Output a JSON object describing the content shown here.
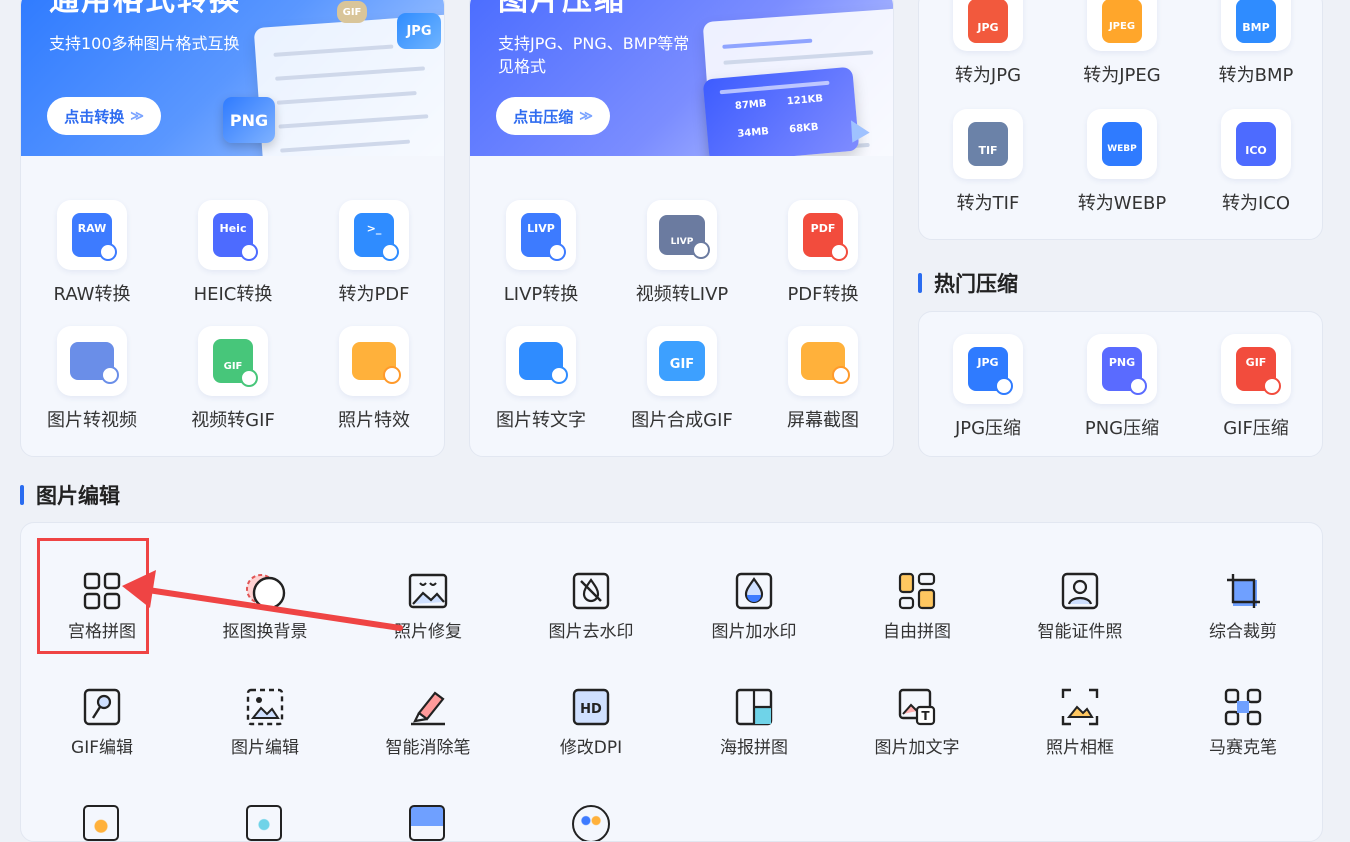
{
  "convert_card": {
    "title": "通用格式转换",
    "subtitle": "支持100多种图片格式互换",
    "button": "点击转换",
    "badge_jpg": "JPG",
    "badge_png": "PNG",
    "badge_gif": "GIF",
    "tiles": [
      {
        "label": "RAW转换",
        "tag": "RAW",
        "color": "#3d7bff"
      },
      {
        "label": "HEIC转换",
        "tag": "Heic",
        "color": "#4d6bff"
      },
      {
        "label": "转为PDF",
        "tag": ">_",
        "color": "#2f8cff"
      },
      {
        "label": "图片转视频",
        "tag": "",
        "color": "#6a8ee8"
      },
      {
        "label": "视频转GIF",
        "tag": "GIF",
        "color": "#47c67a"
      },
      {
        "label": "照片特效",
        "tag": "",
        "color": "#ffb13b"
      }
    ]
  },
  "compress_card": {
    "title": "图片压缩",
    "subtitle": "支持JPG、PNG、BMP等常见格式",
    "button": "点击压缩",
    "panel_a": "87MB",
    "panel_b": "121KB",
    "panel_c": "34MB",
    "panel_d": "68KB",
    "tiles": [
      {
        "label": "LIVP转换",
        "tag": "LIVP",
        "color": "#3d7bff"
      },
      {
        "label": "视频转LIVP",
        "tag": "LIVP",
        "color": "#6b7ba0"
      },
      {
        "label": "PDF转换",
        "tag": "PDF",
        "color": "#f24c3d"
      },
      {
        "label": "图片转文字",
        "tag": "",
        "color": "#2f8cff"
      },
      {
        "label": "图片合成GIF",
        "tag": "GIF",
        "color": "#3da0ff"
      },
      {
        "label": "屏幕截图",
        "tag": "",
        "color": "#ffb13b"
      }
    ]
  },
  "format_card": {
    "tiles": [
      {
        "label": "转为JPG",
        "tag": "JPG",
        "color": "#f2593d"
      },
      {
        "label": "转为JPEG",
        "tag": "JPEG",
        "color": "#ffa62b"
      },
      {
        "label": "转为BMP",
        "tag": "BMP",
        "color": "#2f8cff"
      },
      {
        "label": "转为TIF",
        "tag": "TIF",
        "color": "#6b82a8"
      },
      {
        "label": "转为WEBP",
        "tag": "WEBP",
        "color": "#2f7bff"
      },
      {
        "label": "转为ICO",
        "tag": "ICO",
        "color": "#4d6bff"
      }
    ]
  },
  "hot_compress": {
    "section_title": "热门压缩",
    "tiles": [
      {
        "label": "JPG压缩",
        "tag": "JPG",
        "color": "#2f7bff"
      },
      {
        "label": "PNG压缩",
        "tag": "PNG",
        "color": "#5a6bff"
      },
      {
        "label": "GIF压缩",
        "tag": "GIF",
        "color": "#f24c3d"
      }
    ]
  },
  "image_edit": {
    "section_title": "图片编辑",
    "items": [
      {
        "label": "宫格拼图",
        "icon": "grid-collage-icon"
      },
      {
        "label": "抠图换背景",
        "icon": "cutout-background-icon"
      },
      {
        "label": "照片修复",
        "icon": "photo-repair-icon"
      },
      {
        "label": "图片去水印",
        "icon": "remove-watermark-icon"
      },
      {
        "label": "图片加水印",
        "icon": "add-watermark-icon"
      },
      {
        "label": "自由拼图",
        "icon": "free-collage-icon"
      },
      {
        "label": "智能证件照",
        "icon": "id-photo-icon"
      },
      {
        "label": "综合裁剪",
        "icon": "crop-icon"
      },
      {
        "label": "GIF编辑",
        "icon": "gif-edit-icon"
      },
      {
        "label": "图片编辑",
        "icon": "image-edit-icon"
      },
      {
        "label": "智能消除笔",
        "icon": "eraser-pen-icon"
      },
      {
        "label": "修改DPI",
        "icon": "hd-dpi-icon"
      },
      {
        "label": "海报拼图",
        "icon": "poster-collage-icon"
      },
      {
        "label": "图片加文字",
        "icon": "add-text-icon"
      },
      {
        "label": "照片相框",
        "icon": "photo-frame-icon"
      },
      {
        "label": "马赛克笔",
        "icon": "mosaic-icon"
      }
    ]
  },
  "colors": {
    "accent": "#2a6cf0",
    "highlight": "#ef4444"
  }
}
